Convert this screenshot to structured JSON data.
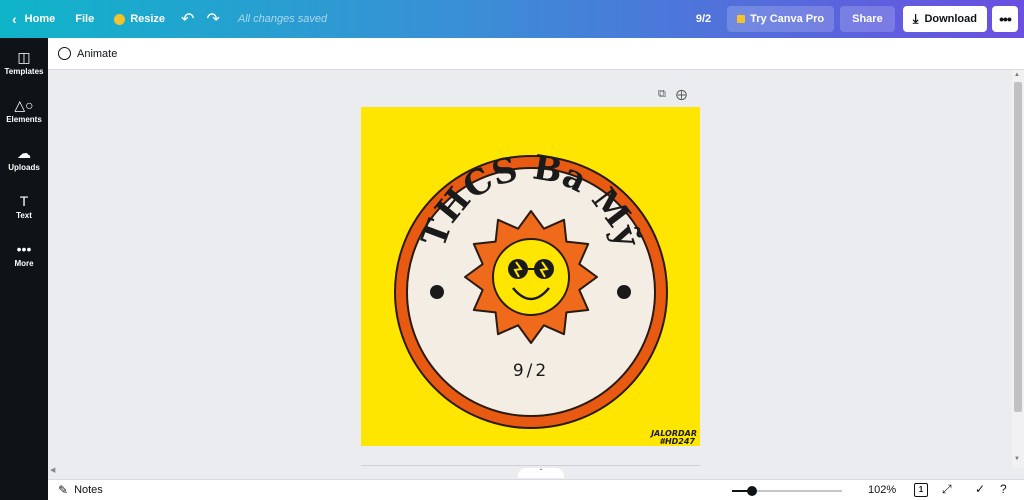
{
  "topbar": {
    "home_label": "Home",
    "file_label": "File",
    "resize_label": "Resize",
    "saved_status": "All changes saved",
    "page_count": "9/2",
    "pro_label": "Try Canva Pro",
    "share_label": "Share",
    "download_label": "Download"
  },
  "sidebar": {
    "items": [
      {
        "label": "Templates",
        "icon": "templates-icon"
      },
      {
        "label": "Elements",
        "icon": "elements-icon"
      },
      {
        "label": "Uploads",
        "icon": "uploads-icon"
      },
      {
        "label": "Text",
        "icon": "text-icon"
      },
      {
        "label": "More",
        "icon": "more-icon"
      }
    ]
  },
  "toolbar": {
    "animate_label": "Animate"
  },
  "design": {
    "headline": "THCS Ba Mỹ",
    "class_label": "9/2",
    "credit_line1": "JALORDAR",
    "credit_line2": "#HD247"
  },
  "bottombar": {
    "notes_label": "Notes",
    "zoom_label": "102%",
    "zoom_fraction": 0.18,
    "pages_count": "1"
  },
  "colors": {
    "canvas_background": "#ffe601",
    "ring_orange": "#e85a12",
    "sun_orange": "#ef6a1a",
    "cream": "#f4ede3",
    "sidebar_dark": "#0e1318"
  }
}
